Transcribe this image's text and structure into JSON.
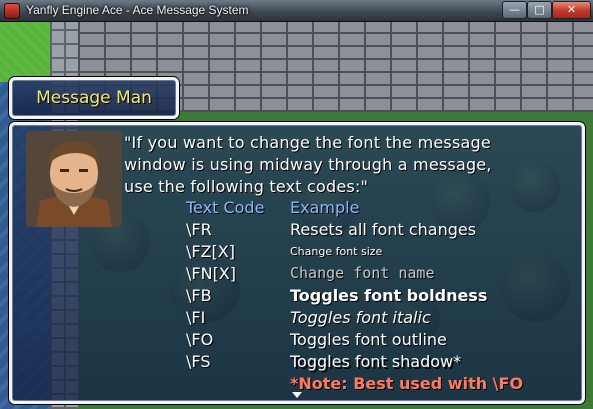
{
  "window": {
    "title": "Yanfly Engine Ace - Ace Message System",
    "minimize_glyph": "—",
    "maximize_glyph": "□",
    "close_glyph": "✕"
  },
  "speaker": {
    "name": "Message Man"
  },
  "message": {
    "lines": [
      "\"If you want to change the font the message",
      "window is using midway through a message,",
      "use the following text codes:\""
    ]
  },
  "table": {
    "header_code": "Text Code",
    "header_desc": "Example",
    "rows": [
      {
        "code": "\\FR",
        "desc": "Resets all font changes"
      },
      {
        "code": "\\FZ[X]",
        "desc": "Change font size"
      },
      {
        "code": "\\FN[X]",
        "desc": "Change font name"
      },
      {
        "code": "\\FB",
        "desc": "Toggles font boldness"
      },
      {
        "code": "\\FI",
        "desc": "Toggles font italic"
      },
      {
        "code": "\\FO",
        "desc": "Toggles font outline"
      },
      {
        "code": "\\FS",
        "desc": "Toggles font shadow*"
      }
    ],
    "note": "*Note: Best used with \\FO"
  },
  "colors": {
    "name_text": "#f6e96e",
    "header_text": "#8fb6ff",
    "note_text": "#ff7a60",
    "window_border": "#f4f4f4"
  },
  "icons": [
    "app-icon",
    "minimize-icon",
    "maximize-icon",
    "close-icon",
    "pause-arrow-icon",
    "portrait"
  ]
}
